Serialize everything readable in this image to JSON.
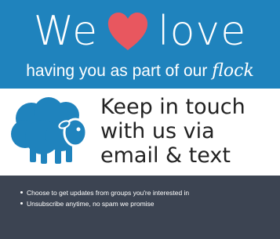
{
  "banner": {
    "headline_left": "We",
    "headline_right": "love",
    "subline_prefix": "having you as part of our",
    "subline_emphasis": "flock"
  },
  "signup": {
    "line1": "Keep in touch",
    "line2": "with us via",
    "line3": "email & text"
  },
  "benefits": [
    "Choose to get updates from groups you're interested in",
    "Unsubscribe anytime, no spam we promise"
  ],
  "colors": {
    "banner": "#1f83bd",
    "heart": "#e8575f",
    "sheep": "#1f83bd",
    "footer": "#3c4452"
  }
}
